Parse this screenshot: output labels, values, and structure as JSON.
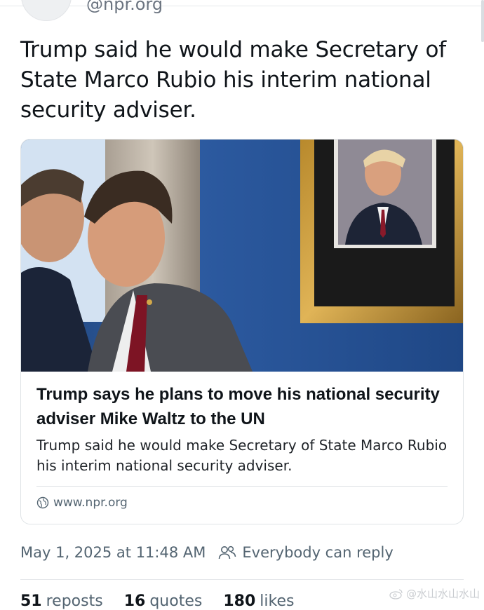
{
  "author": {
    "handle": "@npr.org"
  },
  "post": {
    "text": "Trump said he would make Secretary of State Marco Rubio his interim national security adviser."
  },
  "card": {
    "title": "Trump says he plans to move his national security adviser Mike Waltz to the UN",
    "description": "Trump said he would make Secretary of State Marco Rubio his interim national security adviser.",
    "domain": "www.npr.org"
  },
  "meta": {
    "timestamp": "May 1, 2025 at 11:48 AM",
    "reply_setting": "Everybody can reply"
  },
  "stats": {
    "reposts_count": "51",
    "reposts_label": "reposts",
    "quotes_count": "16",
    "quotes_label": "quotes",
    "likes_count": "180",
    "likes_label": "likes"
  },
  "watermark": {
    "text": "@水山水山水山"
  },
  "colors": {
    "accent": "#536471",
    "text": "#0f1419",
    "wall": "#2a5698"
  }
}
